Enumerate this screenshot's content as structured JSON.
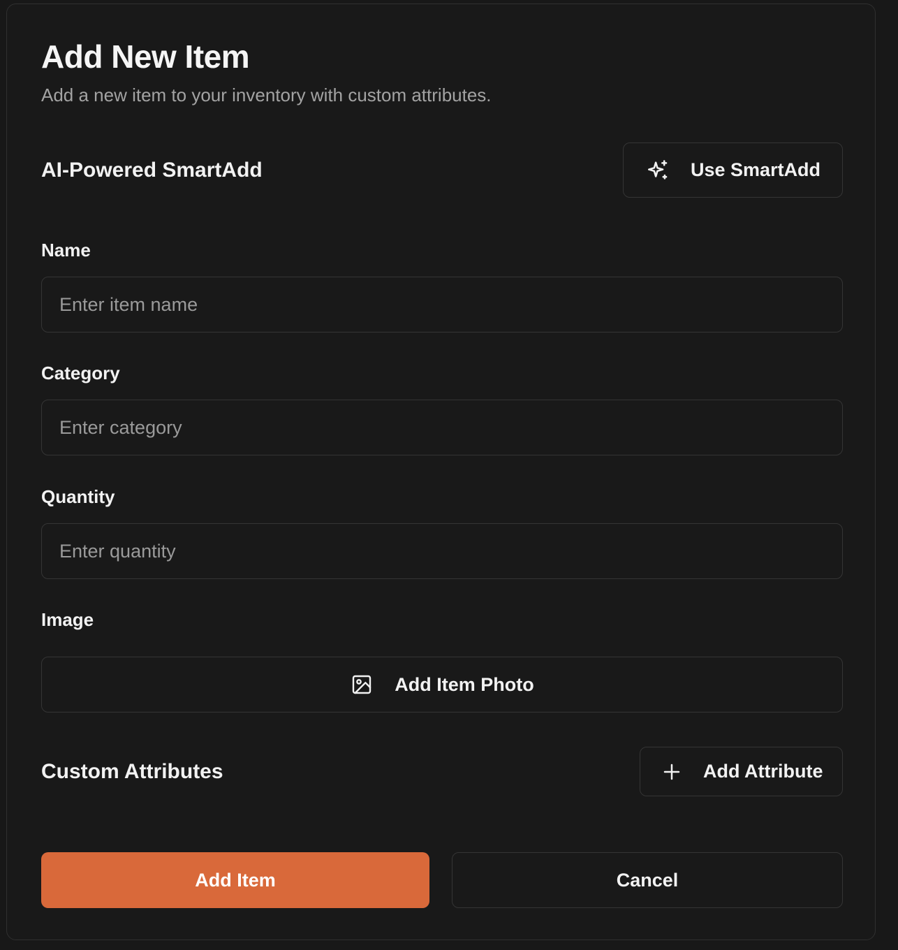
{
  "dialog": {
    "title": "Add New Item",
    "subtitle": "Add a new item to your inventory with custom attributes."
  },
  "smartadd": {
    "heading": "AI-Powered SmartAdd",
    "button_label": "Use SmartAdd",
    "button_icon": "sparkles-icon"
  },
  "form": {
    "name": {
      "label": "Name",
      "value": "",
      "placeholder": "Enter item name"
    },
    "category": {
      "label": "Category",
      "value": "",
      "placeholder": "Enter category"
    },
    "quantity": {
      "label": "Quantity",
      "value": "",
      "placeholder": "Enter quantity"
    },
    "image": {
      "label": "Image",
      "button_label": "Add Item Photo",
      "button_icon": "image-icon"
    }
  },
  "attributes": {
    "heading": "Custom Attributes",
    "add_button_label": "Add Attribute",
    "add_button_icon": "plus-icon"
  },
  "actions": {
    "submit_label": "Add Item",
    "cancel_label": "Cancel"
  },
  "colors": {
    "background": "#181818",
    "border": "#353535",
    "accent": "#d9693a",
    "muted_text": "#a3a3a3"
  }
}
